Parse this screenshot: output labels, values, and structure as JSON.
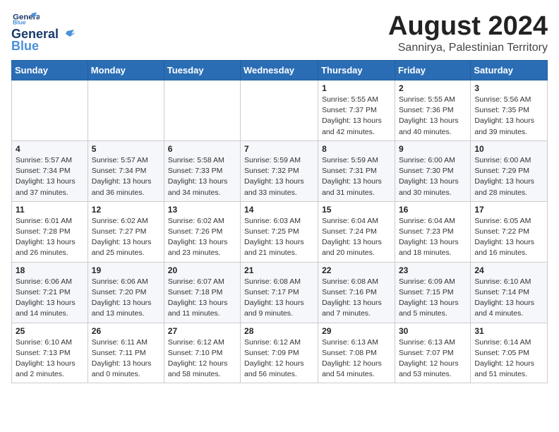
{
  "logo": {
    "line1": "General",
    "line2": "Blue"
  },
  "title": "August 2024",
  "location": "Sannirya, Palestinian Territory",
  "weekdays": [
    "Sunday",
    "Monday",
    "Tuesday",
    "Wednesday",
    "Thursday",
    "Friday",
    "Saturday"
  ],
  "weeks": [
    [
      {
        "day": "",
        "detail": ""
      },
      {
        "day": "",
        "detail": ""
      },
      {
        "day": "",
        "detail": ""
      },
      {
        "day": "",
        "detail": ""
      },
      {
        "day": "1",
        "detail": "Sunrise: 5:55 AM\nSunset: 7:37 PM\nDaylight: 13 hours\nand 42 minutes."
      },
      {
        "day": "2",
        "detail": "Sunrise: 5:55 AM\nSunset: 7:36 PM\nDaylight: 13 hours\nand 40 minutes."
      },
      {
        "day": "3",
        "detail": "Sunrise: 5:56 AM\nSunset: 7:35 PM\nDaylight: 13 hours\nand 39 minutes."
      }
    ],
    [
      {
        "day": "4",
        "detail": "Sunrise: 5:57 AM\nSunset: 7:34 PM\nDaylight: 13 hours\nand 37 minutes."
      },
      {
        "day": "5",
        "detail": "Sunrise: 5:57 AM\nSunset: 7:34 PM\nDaylight: 13 hours\nand 36 minutes."
      },
      {
        "day": "6",
        "detail": "Sunrise: 5:58 AM\nSunset: 7:33 PM\nDaylight: 13 hours\nand 34 minutes."
      },
      {
        "day": "7",
        "detail": "Sunrise: 5:59 AM\nSunset: 7:32 PM\nDaylight: 13 hours\nand 33 minutes."
      },
      {
        "day": "8",
        "detail": "Sunrise: 5:59 AM\nSunset: 7:31 PM\nDaylight: 13 hours\nand 31 minutes."
      },
      {
        "day": "9",
        "detail": "Sunrise: 6:00 AM\nSunset: 7:30 PM\nDaylight: 13 hours\nand 30 minutes."
      },
      {
        "day": "10",
        "detail": "Sunrise: 6:00 AM\nSunset: 7:29 PM\nDaylight: 13 hours\nand 28 minutes."
      }
    ],
    [
      {
        "day": "11",
        "detail": "Sunrise: 6:01 AM\nSunset: 7:28 PM\nDaylight: 13 hours\nand 26 minutes."
      },
      {
        "day": "12",
        "detail": "Sunrise: 6:02 AM\nSunset: 7:27 PM\nDaylight: 13 hours\nand 25 minutes."
      },
      {
        "day": "13",
        "detail": "Sunrise: 6:02 AM\nSunset: 7:26 PM\nDaylight: 13 hours\nand 23 minutes."
      },
      {
        "day": "14",
        "detail": "Sunrise: 6:03 AM\nSunset: 7:25 PM\nDaylight: 13 hours\nand 21 minutes."
      },
      {
        "day": "15",
        "detail": "Sunrise: 6:04 AM\nSunset: 7:24 PM\nDaylight: 13 hours\nand 20 minutes."
      },
      {
        "day": "16",
        "detail": "Sunrise: 6:04 AM\nSunset: 7:23 PM\nDaylight: 13 hours\nand 18 minutes."
      },
      {
        "day": "17",
        "detail": "Sunrise: 6:05 AM\nSunset: 7:22 PM\nDaylight: 13 hours\nand 16 minutes."
      }
    ],
    [
      {
        "day": "18",
        "detail": "Sunrise: 6:06 AM\nSunset: 7:21 PM\nDaylight: 13 hours\nand 14 minutes."
      },
      {
        "day": "19",
        "detail": "Sunrise: 6:06 AM\nSunset: 7:20 PM\nDaylight: 13 hours\nand 13 minutes."
      },
      {
        "day": "20",
        "detail": "Sunrise: 6:07 AM\nSunset: 7:18 PM\nDaylight: 13 hours\nand 11 minutes."
      },
      {
        "day": "21",
        "detail": "Sunrise: 6:08 AM\nSunset: 7:17 PM\nDaylight: 13 hours\nand 9 minutes."
      },
      {
        "day": "22",
        "detail": "Sunrise: 6:08 AM\nSunset: 7:16 PM\nDaylight: 13 hours\nand 7 minutes."
      },
      {
        "day": "23",
        "detail": "Sunrise: 6:09 AM\nSunset: 7:15 PM\nDaylight: 13 hours\nand 5 minutes."
      },
      {
        "day": "24",
        "detail": "Sunrise: 6:10 AM\nSunset: 7:14 PM\nDaylight: 13 hours\nand 4 minutes."
      }
    ],
    [
      {
        "day": "25",
        "detail": "Sunrise: 6:10 AM\nSunset: 7:13 PM\nDaylight: 13 hours\nand 2 minutes."
      },
      {
        "day": "26",
        "detail": "Sunrise: 6:11 AM\nSunset: 7:11 PM\nDaylight: 13 hours\nand 0 minutes."
      },
      {
        "day": "27",
        "detail": "Sunrise: 6:12 AM\nSunset: 7:10 PM\nDaylight: 12 hours\nand 58 minutes."
      },
      {
        "day": "28",
        "detail": "Sunrise: 6:12 AM\nSunset: 7:09 PM\nDaylight: 12 hours\nand 56 minutes."
      },
      {
        "day": "29",
        "detail": "Sunrise: 6:13 AM\nSunset: 7:08 PM\nDaylight: 12 hours\nand 54 minutes."
      },
      {
        "day": "30",
        "detail": "Sunrise: 6:13 AM\nSunset: 7:07 PM\nDaylight: 12 hours\nand 53 minutes."
      },
      {
        "day": "31",
        "detail": "Sunrise: 6:14 AM\nSunset: 7:05 PM\nDaylight: 12 hours\nand 51 minutes."
      }
    ]
  ]
}
